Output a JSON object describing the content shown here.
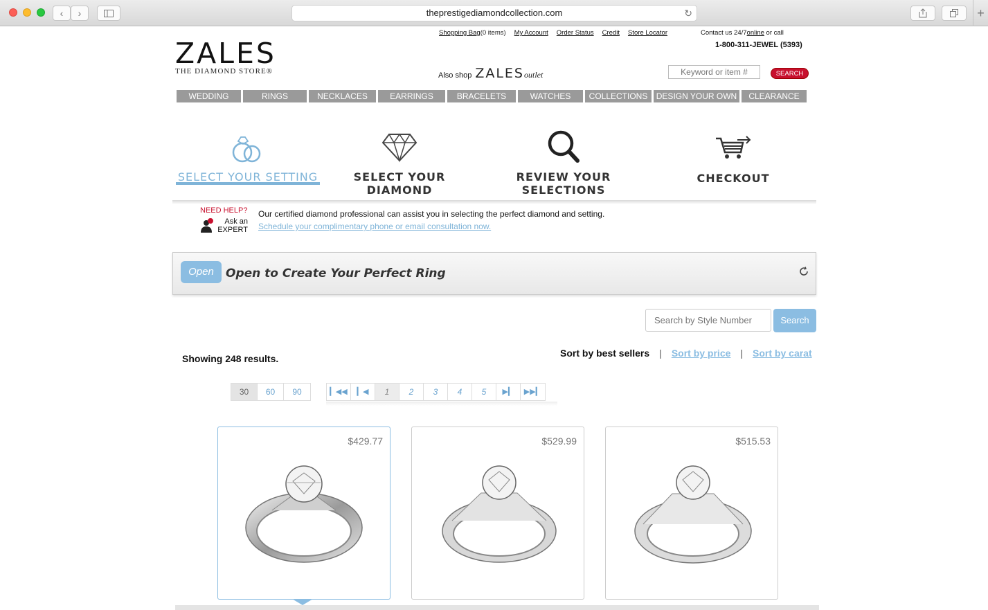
{
  "browser": {
    "url": "theprestigediamondcollection.com"
  },
  "header": {
    "logo_main": "ZALES",
    "logo_sub": "THE DIAMOND STORE®",
    "toplinks": {
      "shopping_bag": "Shopping Bag",
      "bag_count": "(0 items)",
      "my_account": "My Account",
      "order_status": "Order Status",
      "credit": "Credit",
      "store_locator": "Store Locator"
    },
    "contact_prefix": "Contact us 24/7",
    "contact_link": "online",
    "contact_suffix": " or call",
    "phone": "1-800-311-JEWEL (5393)",
    "also_shop": "Also shop",
    "outlet_brand": "ZALES",
    "outlet_word": "outlet",
    "search_placeholder": "Keyword or item #",
    "search_button": "SEARCH"
  },
  "nav": [
    "WEDDING",
    "RINGS",
    "NECKLACES",
    "EARRINGS",
    "BRACELETS",
    "WATCHES",
    "COLLECTIONS",
    "DESIGN YOUR OWN",
    "CLEARANCE"
  ],
  "steps": {
    "select_setting": "SELECT YOUR SETTING",
    "select_diamond": "SELECT YOUR DIAMOND",
    "review": "REVIEW YOUR SELECTIONS",
    "checkout": "CHECKOUT"
  },
  "help": {
    "need_help": "NEED HELP?",
    "ask_line1": "Ask an",
    "ask_line2": "EXPERT",
    "text": "Our certified diamond professional can assist you in selecting the perfect diamond and setting.",
    "link": "Schedule your complimentary phone or email consultation now."
  },
  "accordion": {
    "open_label": "Open",
    "title": "Open to Create Your Perfect Ring"
  },
  "style_search": {
    "placeholder": "Search by Style Number",
    "button": "Search"
  },
  "results_text": "Showing 248 results.",
  "sort": {
    "best_sellers": "Sort by best sellers",
    "price": "Sort by price",
    "carat": "Sort by carat",
    "separator": "|"
  },
  "per_page": [
    "30",
    "60",
    "90"
  ],
  "pages": [
    "1",
    "2",
    "3",
    "4",
    "5"
  ],
  "products": [
    {
      "price": "$429.77"
    },
    {
      "price": "$529.99"
    },
    {
      "price": "$515.53"
    }
  ],
  "colors": {
    "accent_blue": "#8bbde2",
    "brand_red": "#c8102e",
    "nav_gray": "#9a9a9a"
  }
}
